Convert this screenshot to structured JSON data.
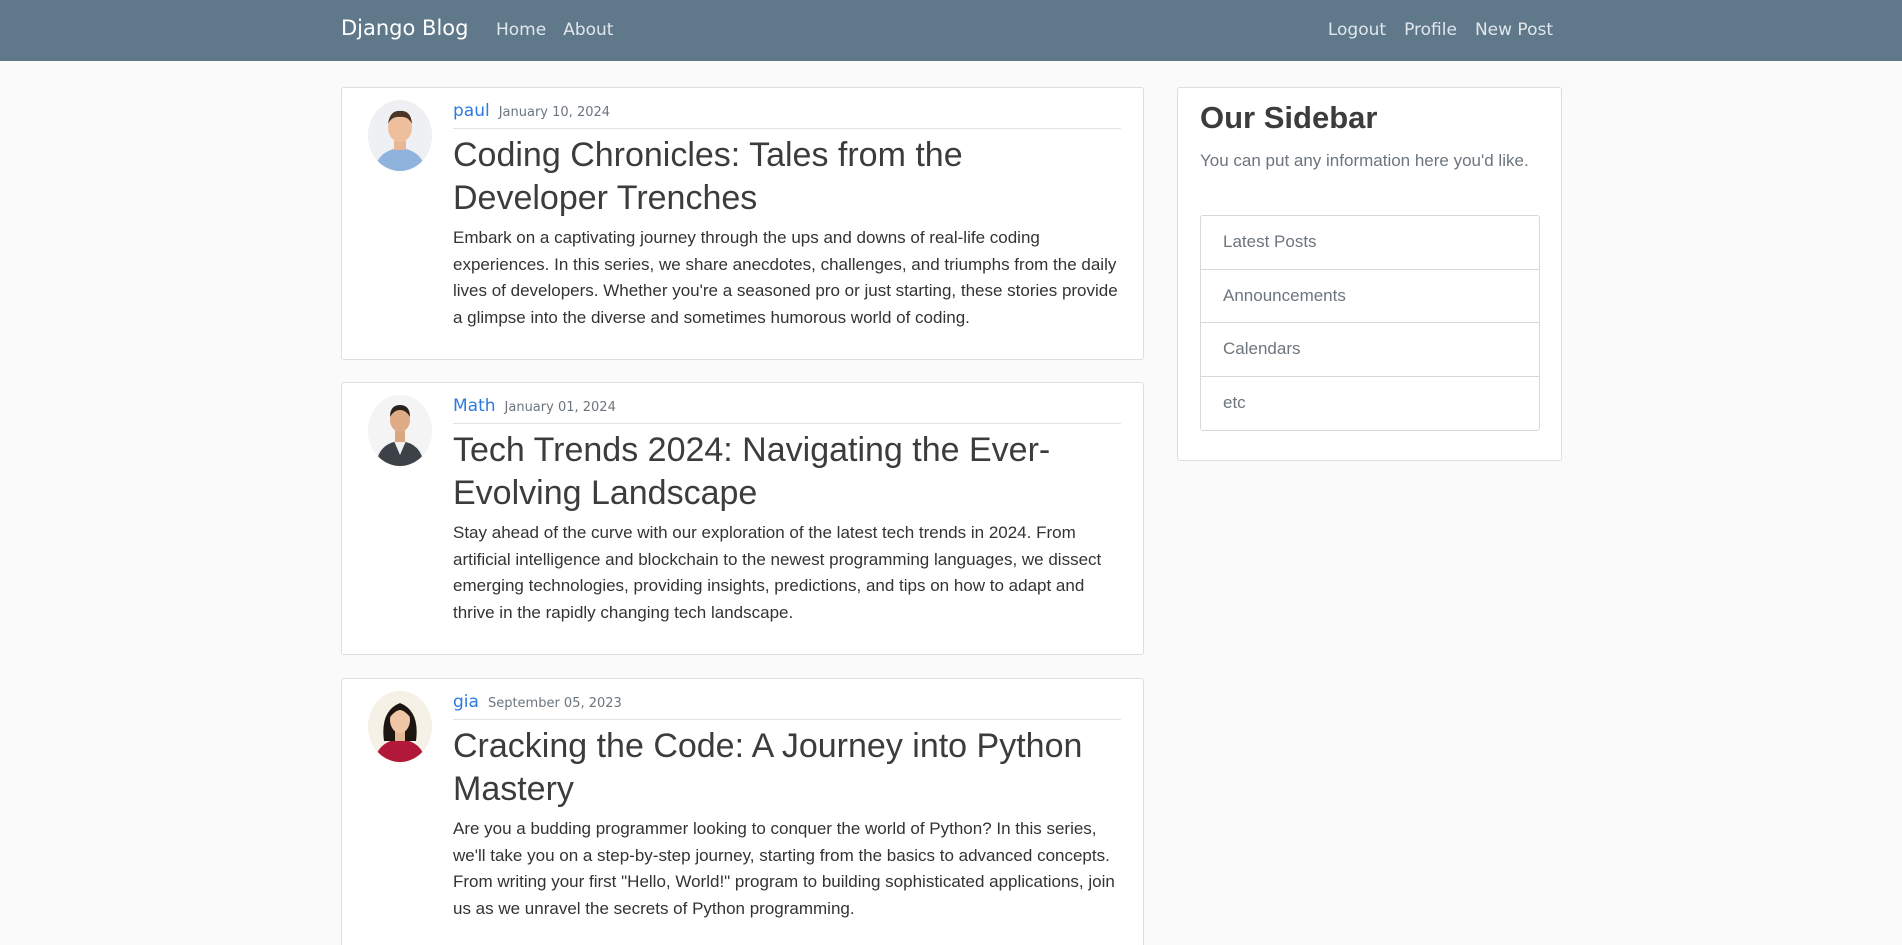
{
  "navbar": {
    "brand": "Django Blog",
    "left_links": [
      "Home",
      "About"
    ],
    "right_links": [
      "Logout",
      "Profile",
      "New Post"
    ]
  },
  "posts": [
    {
      "author": "paul",
      "date": "January 10, 2024",
      "title": "Coding Chronicles: Tales from the Developer Trenches",
      "excerpt": "Embark on a captivating journey through the ups and downs of real-life coding experiences. In this series, we share anecdotes, challenges, and triumphs from the daily lives of developers. Whether you're a seasoned pro or just starting, these stories provide a glimpse into the diverse and sometimes humorous world of coding."
    },
    {
      "author": "Math",
      "date": "January 01, 2024",
      "title": "Tech Trends 2024: Navigating the Ever-Evolving Landscape",
      "excerpt": "Stay ahead of the curve with our exploration of the latest tech trends in 2024. From artificial intelligence and blockchain to the newest programming languages, we dissect emerging technologies, providing insights, predictions, and tips on how to adapt and thrive in the rapidly changing tech landscape."
    },
    {
      "author": "gia",
      "date": "September 05, 2023",
      "title": "Cracking the Code: A Journey into Python Mastery",
      "excerpt": "Are you a budding programmer looking to conquer the world of Python? In this series, we'll take you on a step-by-step journey, starting from the basics to advanced concepts. From writing your first \"Hello, World!\" program to building sophisticated applications, join us as we unravel the secrets of Python programming."
    }
  ],
  "sidebar": {
    "heading": "Our Sidebar",
    "description": "You can put any information here you'd like.",
    "items": [
      "Latest Posts",
      "Announcements",
      "Calendars",
      "etc"
    ]
  }
}
